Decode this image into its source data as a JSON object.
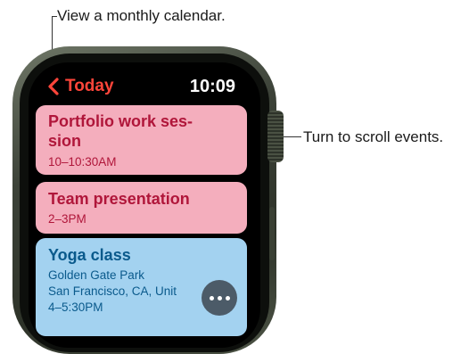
{
  "callouts": {
    "top": "View a monthly calendar.",
    "right": "Turn to scroll events."
  },
  "header": {
    "back_label": "Today",
    "time": "10:09"
  },
  "events": [
    {
      "title": "Portfolio work session",
      "title_display": "Portfolio work ses-\nsion",
      "time": "10–10:30AM",
      "color": "#f4aebd",
      "text_color": "#b0163a"
    },
    {
      "title": "Team presentation",
      "time": "2–3PM",
      "color": "#f4aebd",
      "text_color": "#b0163a"
    },
    {
      "title": "Yoga class",
      "location_name": "Golden Gate Park",
      "location_address": "San Francisco, CA, Unit",
      "time": "4–5:30PM",
      "color": "#a3d2f0",
      "text_color": "#0a5a8c"
    }
  ],
  "colors": {
    "accent": "#ff453a",
    "more_button": "#4c5b68"
  },
  "icons": {
    "back": "chevron-left-icon",
    "more": "ellipsis-icon"
  }
}
